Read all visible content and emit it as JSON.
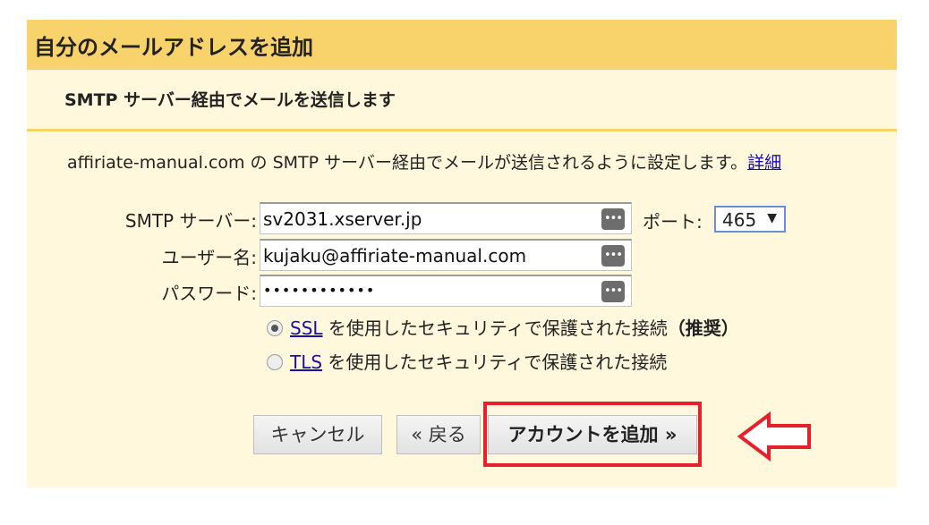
{
  "dialog": {
    "title": "自分のメールアドレスを追加",
    "subheader": "SMTP サーバー経由でメールを送信します",
    "description": "affiriate-manual.com の SMTP サーバー経由でメールが送信されるように設定します。",
    "details_link": "詳細"
  },
  "form": {
    "smtp_label": "SMTP サーバー:",
    "smtp_value": "sv2031.xserver.jp",
    "port_label": "ポート:",
    "port_value": "465",
    "username_label": "ユーザー名:",
    "username_value": "kujaku@affiriate-manual.com",
    "password_label": "パスワード:",
    "password_value": "••••••••••••",
    "field_icon": "•••"
  },
  "security": {
    "ssl_link": "SSL",
    "ssl_text": " を使用したセキュリティで保護された接続",
    "ssl_recommended": "（推奨）",
    "ssl_selected": true,
    "tls_link": "TLS",
    "tls_text": " を使用したセキュリティで保護された接続"
  },
  "buttons": {
    "cancel": "キャンセル",
    "back": "« 戻る",
    "add_account": "アカウントを追加 »"
  },
  "annotation": {
    "highlight_color": "#e8202c",
    "arrow_direction": "left"
  }
}
